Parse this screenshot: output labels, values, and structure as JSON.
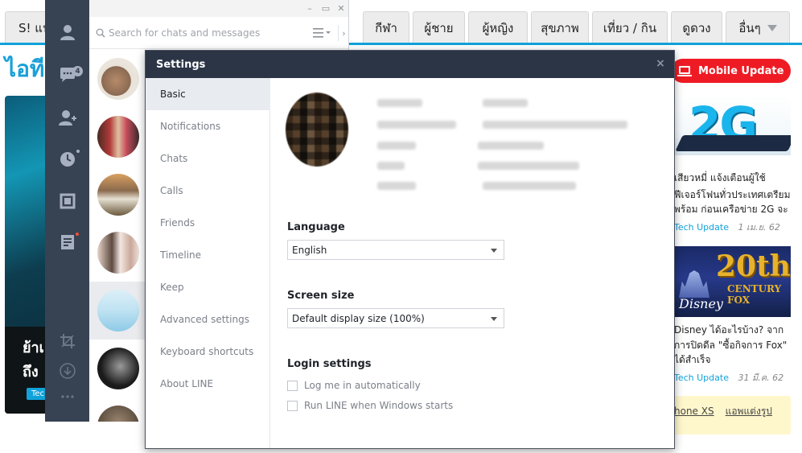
{
  "website": {
    "nav_tabs": [
      {
        "label": "S! แน"
      },
      {
        "label": "กีฬา"
      },
      {
        "label": "ผู้ชาย"
      },
      {
        "label": "ผู้หญิง"
      },
      {
        "label": "สุขภาพ"
      },
      {
        "label": "เที่ยว / กิน"
      },
      {
        "label": "ดูดวง"
      },
      {
        "label": "อื่นๆ"
      }
    ],
    "logo_partial": "ไอที",
    "hero": {
      "title_line1": "ย้าเ",
      "title_line2": "ถึง",
      "tag": "Tec"
    },
    "mobile_update_label": "Mobile Update",
    "news": [
      {
        "thumb_text": "2G",
        "line1": "เสียวหมี่ แจ้งเตือนผู้ใช้",
        "line2": "ฟีเจอร์โฟนทั่วประเทศเตรียม",
        "line3": "พร้อม ก่อนเครือข่าย 2G จะ",
        "category": "Tech Update",
        "date": "1 เม.ย. 62"
      },
      {
        "thumb_text": "20th",
        "thumb_sub": "CENTURY FOX",
        "thumb_brand": "Disney",
        "line1": "Disney ได้อะไรบ้าง? จาก",
        "line2": "การปิดดีล \"ซื้อกิจการ Fox\"",
        "line3": "ได้สำเร็จ",
        "category": "Tech Update",
        "date": "31 มี.ค. 62"
      }
    ],
    "yellow_links": [
      "hone XS",
      "แอพแต่งรูป"
    ]
  },
  "line_app": {
    "chat_badge_count": "4",
    "search": {
      "placeholder": "Search for chats and messages"
    },
    "window_controls": {
      "minimize": "–",
      "maximize": "▭",
      "close": "✕"
    },
    "collapse_glyph": "›",
    "chats": [
      {
        "name": "chat-1",
        "color_a": "#b78a6a",
        "color_b": "#7a5a45"
      },
      {
        "name": "chat-2",
        "color_a": "#b23a3a",
        "color_b": "#4a2a22"
      },
      {
        "name": "chat-3",
        "color_a": "#d9a062",
        "color_b": "#6b5a3d"
      },
      {
        "name": "chat-4",
        "color_a": "#e7d4c9",
        "color_b": "#5e4a40"
      },
      {
        "name": "chat-5",
        "color_a": "#8ecae6",
        "color_b": "#dceff8"
      },
      {
        "name": "chat-6",
        "color_a": "#1a1a1a",
        "color_b": "#9a9a9a"
      },
      {
        "name": "chat-7",
        "color_a": "#9a8570",
        "color_b": "#5f5040"
      }
    ]
  },
  "settings": {
    "title": "Settings",
    "close_glyph": "×",
    "nav": [
      {
        "label": "Basic",
        "active": true
      },
      {
        "label": "Notifications"
      },
      {
        "label": "Chats"
      },
      {
        "label": "Calls"
      },
      {
        "label": "Friends"
      },
      {
        "label": "Timeline"
      },
      {
        "label": "Keep"
      },
      {
        "label": "Advanced settings"
      },
      {
        "label": "Keyboard shortcuts"
      },
      {
        "label": "About LINE"
      }
    ],
    "language": {
      "label": "Language",
      "value": "English"
    },
    "screen_size": {
      "label": "Screen size",
      "value": "Default display size (100%)"
    },
    "login": {
      "label": "Login settings",
      "options": [
        {
          "label": "Log me in automatically",
          "checked": false
        },
        {
          "label": "Run LINE when Windows starts",
          "checked": false
        }
      ]
    }
  },
  "colors": {
    "line_sidebar": "#374253",
    "dialog_header": "#2b3546",
    "site_accent": "#11a2da",
    "mobile_update_red": "#ef1b24"
  }
}
